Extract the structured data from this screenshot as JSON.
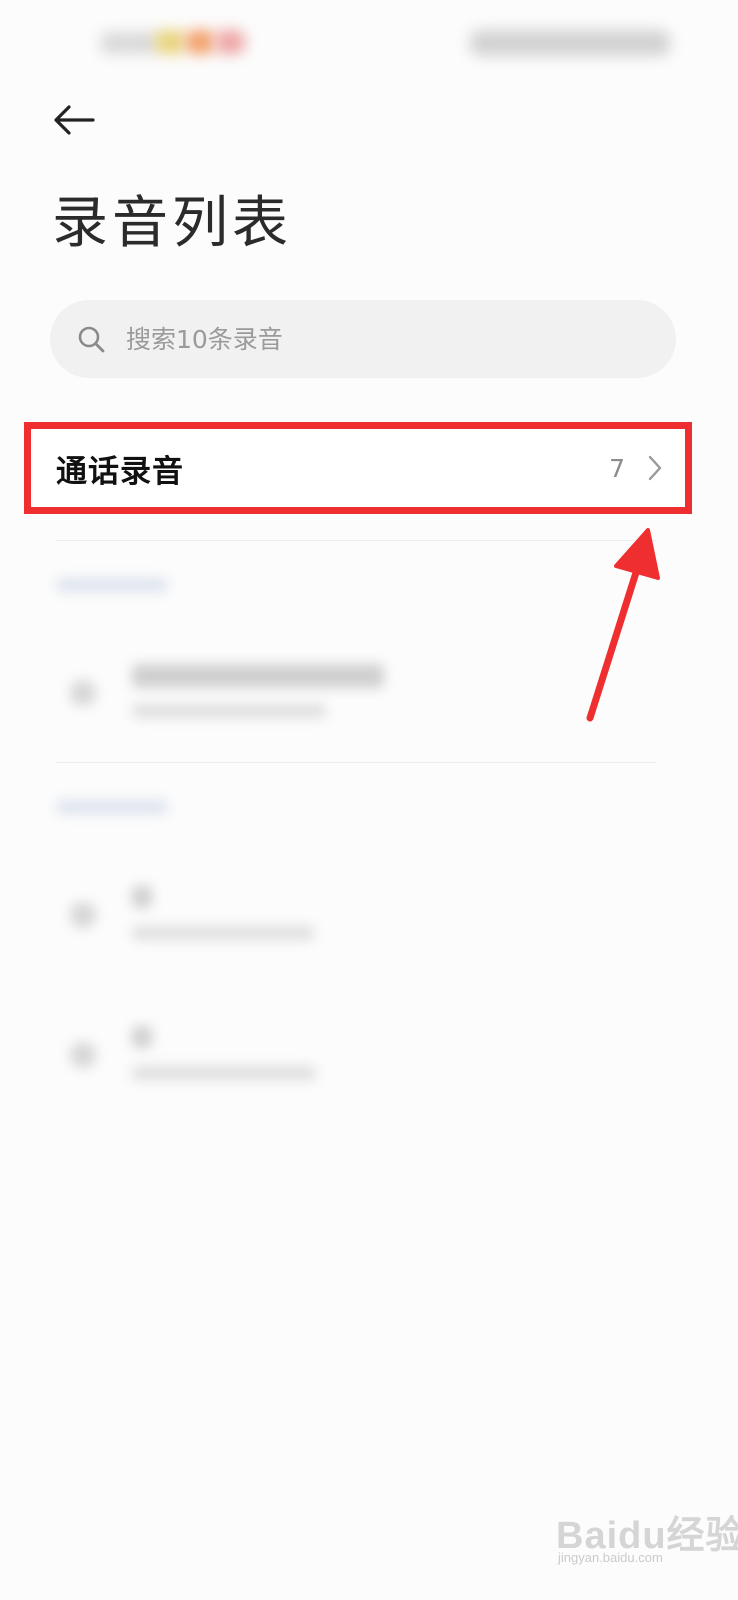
{
  "header": {
    "back_icon": "arrow-left-icon",
    "title": "录音列表"
  },
  "search": {
    "icon": "search-icon",
    "placeholder": "搜索10条录音"
  },
  "call_recordings": {
    "label": "通话录音",
    "count": "7",
    "chevron_icon": "chevron-right-icon"
  },
  "colors": {
    "highlight_border": "#ef2f2f",
    "annotation_arrow": "#ef2f2f",
    "background": "#fcfcfc",
    "search_bg": "#f1f1f1"
  },
  "watermark": {
    "brand": "Baidu经验",
    "url": "jingyan.baidu.com"
  }
}
